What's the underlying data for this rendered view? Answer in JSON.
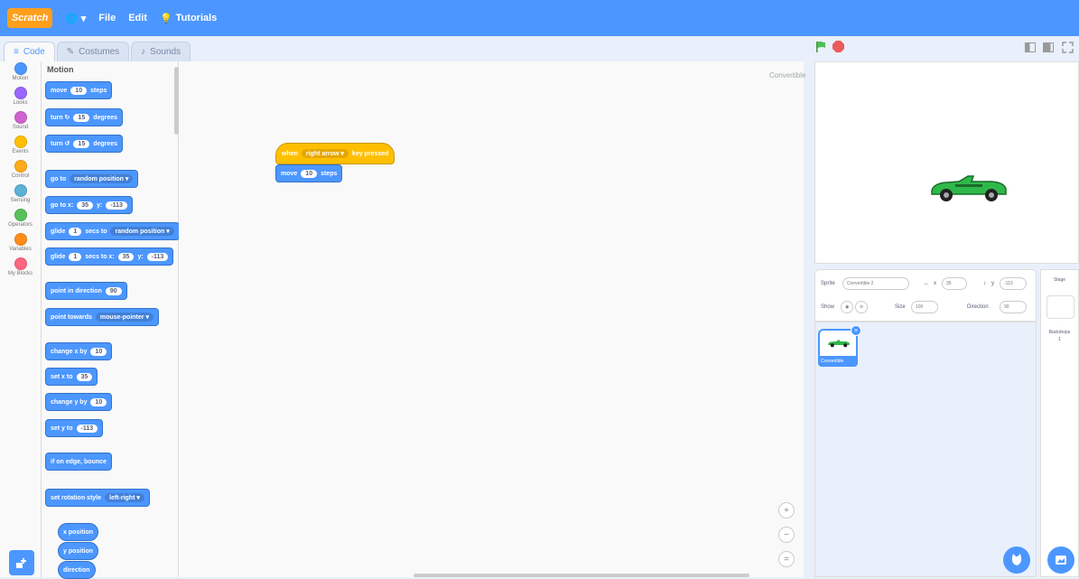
{
  "menubar": {
    "logo": "Scratch",
    "language": "",
    "file": "File",
    "edit": "Edit",
    "tutorials": "Tutorials"
  },
  "tabs": [
    "Code",
    "Costumes",
    "Sounds"
  ],
  "categories": [
    {
      "label": "Motion",
      "color": "#4c97ff"
    },
    {
      "label": "Looks",
      "color": "#9966ff"
    },
    {
      "label": "Sound",
      "color": "#cf63cf"
    },
    {
      "label": "Events",
      "color": "#ffbf00"
    },
    {
      "label": "Control",
      "color": "#ffab19"
    },
    {
      "label": "Sensing",
      "color": "#5cb1d6"
    },
    {
      "label": "Operators",
      "color": "#59c059"
    },
    {
      "label": "Variables",
      "color": "#ff8c1a"
    },
    {
      "label": "My Blocks",
      "color": "#ff6680"
    }
  ],
  "palette": {
    "heading": "Motion",
    "blocks": {
      "move": {
        "text": "move",
        "value": "10",
        "suffix": "steps"
      },
      "turn_right": {
        "text": "turn ↻",
        "value": "15",
        "suffix": "degrees"
      },
      "turn_left": {
        "text": "turn ↺",
        "value": "15",
        "suffix": "degrees"
      },
      "goto": {
        "text": "go to",
        "menu": "random position ▾"
      },
      "goto_xy": {
        "text": "go to x:",
        "x": "35",
        "y_label": "y:",
        "y": "-113"
      },
      "glide_to": {
        "text": "glide",
        "value": "1",
        "mid": "secs to",
        "menu": "random position ▾"
      },
      "glide_xy": {
        "text": "glide",
        "value": "1",
        "mid": "secs to x:",
        "x": "35",
        "y_label": "y:",
        "y": "-113"
      },
      "point_dir": {
        "text": "point in direction",
        "value": "90"
      },
      "point_towards": {
        "text": "point towards",
        "menu": "mouse-pointer ▾"
      },
      "change_x": {
        "text": "change x by",
        "value": "10"
      },
      "set_x": {
        "text": "set x to",
        "value": "35"
      },
      "change_y": {
        "text": "change y by",
        "value": "10"
      },
      "set_y": {
        "text": "set y to",
        "value": "-113"
      },
      "bounce": {
        "text": "if on edge, bounce"
      },
      "rotation_style": {
        "text": "set rotation style",
        "menu": "left-right ▾"
      },
      "xpos": {
        "text": "x position"
      },
      "ypos": {
        "text": "y position"
      },
      "direction": {
        "text": "direction"
      }
    }
  },
  "workspace": {
    "sprite_tag": "Convertible",
    "hat": {
      "text": "when",
      "menu": "right arrow ▾",
      "suffix": "key pressed"
    },
    "move": {
      "text": "move",
      "value": "10",
      "suffix": "steps"
    },
    "zoom_in": "+",
    "zoom_out": "−",
    "zoom_reset": "="
  },
  "sprite_info": {
    "sprite_label": "Sprite",
    "sprite_name": "Convertible 2",
    "x_label": "x",
    "x": "35",
    "y_label": "y",
    "y": "-113",
    "show_label": "Show",
    "size_label": "Size",
    "size": "100",
    "direction_label": "Direction",
    "direction": "90"
  },
  "sprite_list": {
    "thumb_name": "Convertible"
  },
  "stage_panel": {
    "label": "Stage",
    "backdrops_label": "Backdrops",
    "backdrops_count": "1"
  }
}
